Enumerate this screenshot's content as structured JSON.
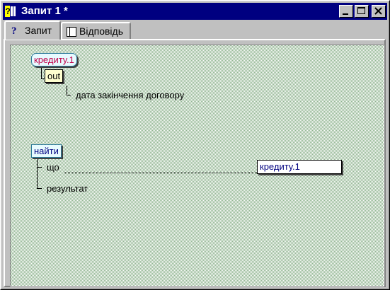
{
  "window": {
    "title": "Запит 1 *",
    "controls": {
      "minimize": "minimize-icon",
      "maximize": "maximize-icon",
      "close": "close-icon"
    }
  },
  "tabs": [
    {
      "label": "Запит",
      "icon": "question-icon",
      "active": true
    },
    {
      "label": "Відповідь",
      "icon": "table-icon",
      "active": false
    }
  ],
  "diagram": {
    "source_node": "кредиту.1",
    "out_node": "out",
    "out_field": "дата закінчення договору",
    "find_node": "найти",
    "what_label": "що",
    "result_label": "результат",
    "target_node": "кредиту.1"
  },
  "colors": {
    "titlebar": "#000080",
    "canvas": "#c2ddc2",
    "node_text_red": "#c0004a",
    "node_text_blue": "#000080"
  }
}
